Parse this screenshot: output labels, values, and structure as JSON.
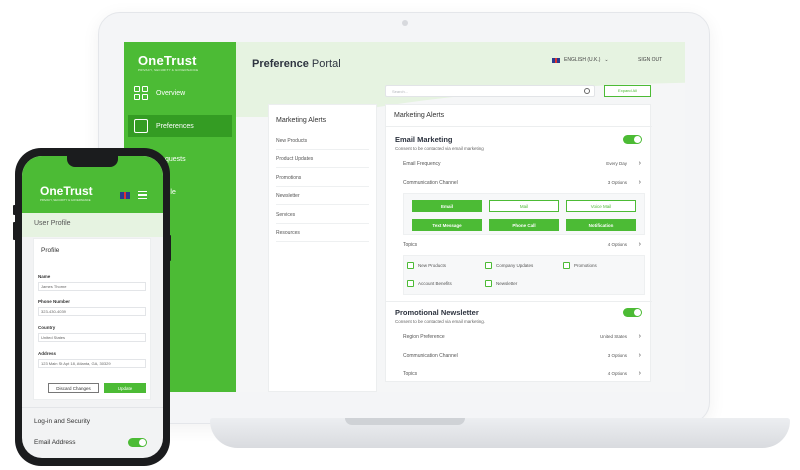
{
  "laptop": {
    "brand": "OneTrust",
    "brand_tagline": "PRIVACY, SECURITY & GOVERNANCE",
    "nav": [
      {
        "label": "Overview",
        "icon": "grid-icon"
      },
      {
        "label": "Preferences",
        "icon": "sliders-icon",
        "active": true
      },
      {
        "label": "Requests",
        "icon": "list-icon"
      },
      {
        "label": "Profile",
        "icon": "user-icon"
      }
    ],
    "header": {
      "title_bold": "Preference",
      "title_rest": " Portal",
      "language": "ENGLISH (U.K.)",
      "sign_out": "SIGN OUT"
    },
    "search": {
      "placeholder": "Search..."
    },
    "expand_all": "Expand All",
    "left_menu": {
      "heading": "Marketing Alerts",
      "items": [
        "New Products",
        "Product Updates",
        "Promotions",
        "Newsletter",
        "Services",
        "Resources"
      ]
    },
    "main": {
      "title": "Marketing Alerts",
      "email_marketing": {
        "title": "Email Marketing",
        "subtitle": "Consent to be contacted via email marketing",
        "rows": [
          {
            "label": "Email Frequency",
            "value": "Every Day"
          },
          {
            "label": "Communication Channel",
            "value": "3 Options"
          }
        ],
        "channels": [
          {
            "label": "Email",
            "selected": true
          },
          {
            "label": "Mail",
            "selected": false
          },
          {
            "label": "Voice Mail",
            "selected": false
          },
          {
            "label": "Text Message",
            "selected": true
          },
          {
            "label": "Phone Call",
            "selected": true
          },
          {
            "label": "Notification",
            "selected": true
          }
        ],
        "topics_row": {
          "label": "Topics",
          "value": "4 Options"
        },
        "topics": [
          "New Products",
          "Company Updates",
          "Promotions",
          "Account Benefits",
          "Newsletter"
        ]
      },
      "newsletter": {
        "title": "Promotional Newsletter",
        "subtitle": "Consent to be contacted via email marketing.",
        "rows": [
          {
            "label": "Region Preference",
            "value": "United States"
          },
          {
            "label": "Communication Channel",
            "value": "3 Options"
          },
          {
            "label": "Topics",
            "value": "4 Options"
          }
        ]
      }
    }
  },
  "phone": {
    "brand": "OneTrust",
    "brand_tagline": "PRIVACY, SECURITY & GOVERNANCE",
    "section_label": "User Profile",
    "card_heading": "Profile",
    "fields": [
      {
        "label": "Name",
        "value": "James Thorne"
      },
      {
        "label": "Phone Number",
        "value": "323-430-4039"
      },
      {
        "label": "Country",
        "value": "United States"
      },
      {
        "label": "Address",
        "value": "123 Main St Apt 18, Atlanta, GA, 30329"
      }
    ],
    "discard": "Discard Changes",
    "update": "Update",
    "security": "Log-in and Security",
    "email_address": "Email Address"
  },
  "colors": {
    "brand_green": "#4cbb35",
    "brand_green_dark": "#349c23",
    "tint": "#e6f3e1"
  }
}
